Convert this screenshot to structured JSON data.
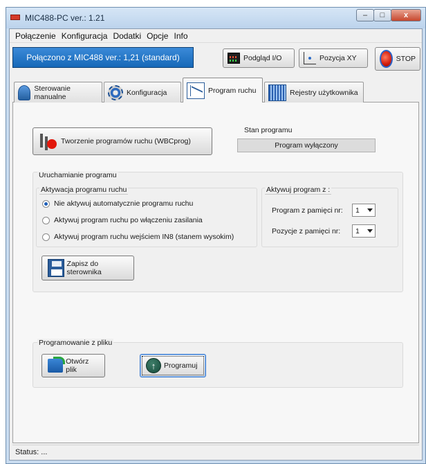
{
  "window": {
    "title": "MIC488-PC  ver.: 1.21",
    "controls": {
      "minimize": "–",
      "maximize": "□",
      "close": "x"
    }
  },
  "menu": [
    "Połączenie",
    "Konfiguracja",
    "Dodatki",
    "Opcje",
    "Info"
  ],
  "toolbar": {
    "connection": "Połączono z MIC488 ver.: 1,21  (standard)",
    "io_preview": "Podgląd I/O",
    "xy_position": "Pozycja XY",
    "stop": "STOP"
  },
  "tabs": [
    {
      "label": "Sterowanie manualne",
      "icon": "manual-control-icon"
    },
    {
      "label": "Konfiguracja",
      "icon": "gear-icon"
    },
    {
      "label": "Program ruchu",
      "icon": "motion-program-icon",
      "active": true
    },
    {
      "label": "Rejestry użytkownika",
      "icon": "registers-icon"
    }
  ],
  "program_tab": {
    "create_button": "Tworzenie programów ruchu (WBCprog)",
    "state_label": "Stan programu",
    "state_value": "Program wyłączony",
    "run_group": {
      "title": "Uruchamianie programu",
      "activation": {
        "title": "Aktywacja programu ruchu",
        "options": [
          "Nie aktywuj automatycznie programu ruchu",
          "Aktywuj program ruchu po włączeniu zasilania",
          "Aktywuj program ruchu wejściem IN8 (stanem wysokim)"
        ],
        "selected_index": 0
      },
      "activate_from": {
        "title": "Aktywuj program z :",
        "memory_program_label": "Program z pamięci nr:",
        "memory_program_value": "1",
        "memory_positions_label": "Pozycje z pamięci nr:",
        "memory_positions_value": "1"
      },
      "save_button": "Zapisz do sterownika"
    },
    "file_group": {
      "title": "Programowanie  z pliku",
      "open_button": "Otwórz plik",
      "program_button": "Programuj"
    }
  },
  "status": "Status:  ..."
}
